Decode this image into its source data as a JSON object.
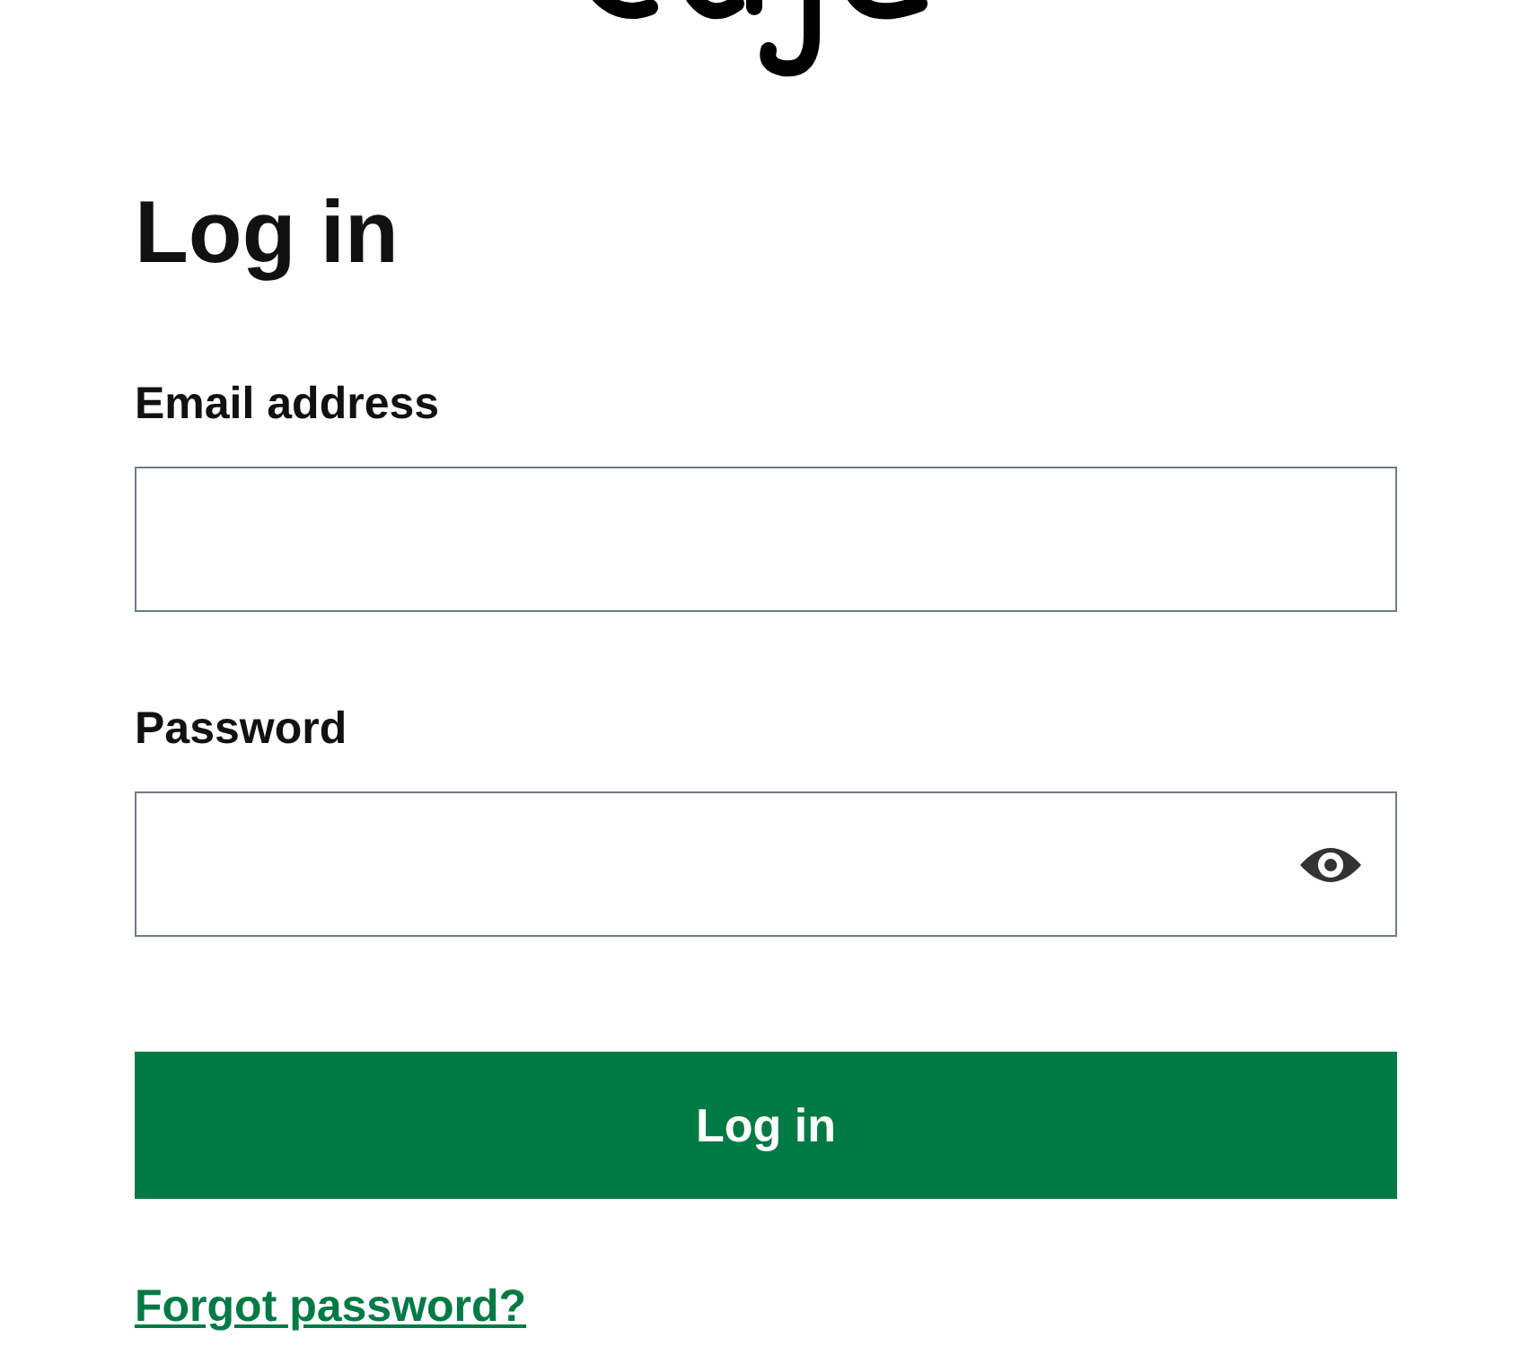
{
  "heading": "Log in",
  "fields": [
    {
      "label": "Email address",
      "kind": "text"
    },
    {
      "label": "Password",
      "kind": "password"
    }
  ],
  "submit": "Log in",
  "forgot_link": "Forgot password?"
}
